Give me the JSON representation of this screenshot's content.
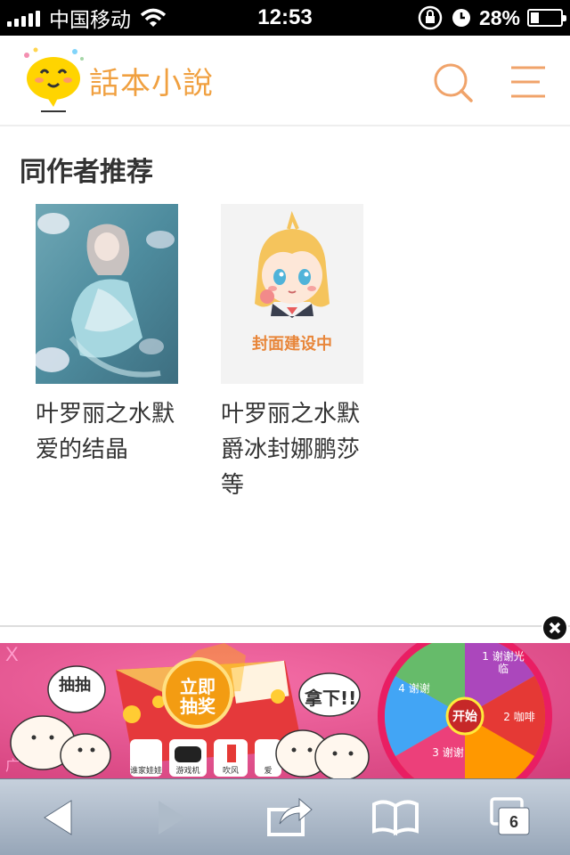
{
  "status_bar": {
    "carrier": "中国移动",
    "time": "12:53",
    "battery": "28%",
    "battery_level": 0.28
  },
  "header": {
    "logo_text": "話本小說",
    "search_icon": "search-icon",
    "menu_icon": "hamburger-menu-icon",
    "accent_color": "#f0a36a"
  },
  "section": {
    "title": "同作者推荐"
  },
  "books": [
    {
      "title": "叶罗丽之水默爱的结晶",
      "cover": "doll-illustration"
    },
    {
      "title": "叶罗丽之水默爵冰封娜鹏莎等",
      "cover": "cover-under-construction",
      "placeholder_text": "封面建设中"
    }
  ],
  "ad": {
    "button_text": "立即抽奖",
    "left_bubble": "抽抽",
    "right_bubble": "拿下!!",
    "wheel_center": "开始",
    "wheel_segments": [
      "1 谢谢光临",
      "2 咖啡",
      "3 谢谢",
      "4 谢谢"
    ],
    "left_mark": "X",
    "corner_label": "广",
    "prize_labels": [
      "谁家娃娃",
      "游戏机",
      "吹风",
      "爱"
    ]
  },
  "toolbar": {
    "back_icon": "back-arrow-icon",
    "forward_icon": "forward-arrow-icon",
    "share_icon": "share-icon",
    "bookmarks_icon": "book-icon",
    "tabs_icon": "tabs-icon",
    "tabs_count": "6"
  }
}
